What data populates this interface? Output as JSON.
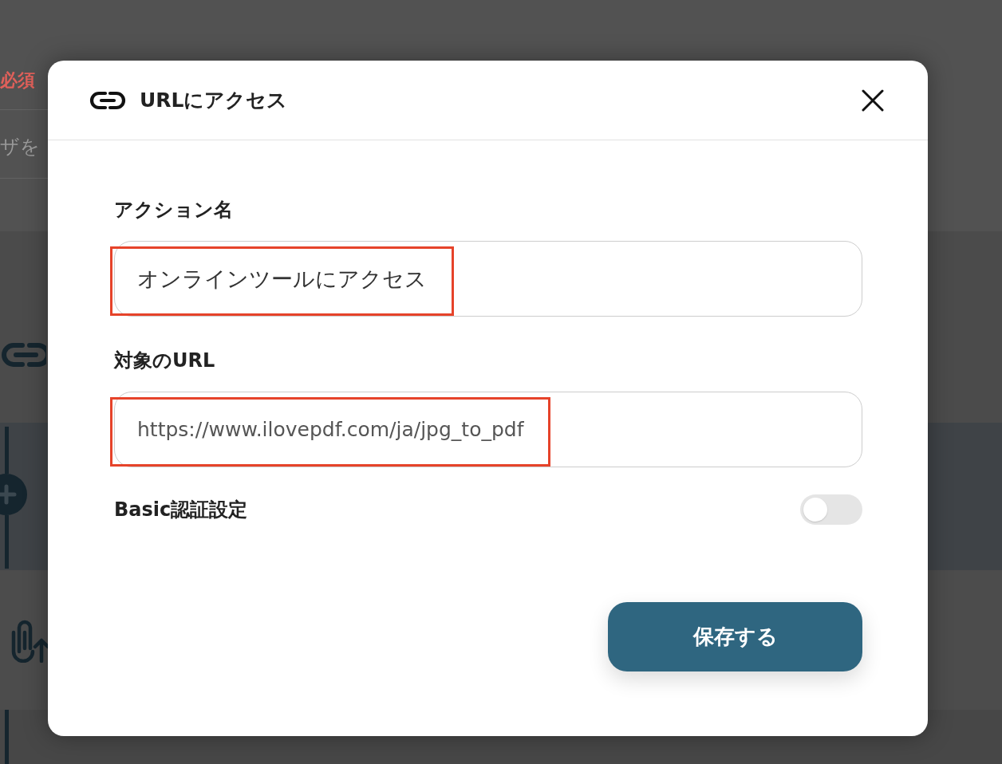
{
  "background_page": {
    "required_mark": "必須",
    "field_hint": "ザを"
  },
  "dialog": {
    "title": "URLにアクセス",
    "fields": [
      {
        "label": "アクション名",
        "value": "オンラインツールにアクセス",
        "highlighted": true
      },
      {
        "label": "対象のURL",
        "value": "https://www.ilovepdf.com/ja/jpg_to_pdf",
        "highlighted": true
      }
    ],
    "basic_auth": {
      "label": "Basic認証設定",
      "on": false
    },
    "save_button": "保存する"
  }
}
